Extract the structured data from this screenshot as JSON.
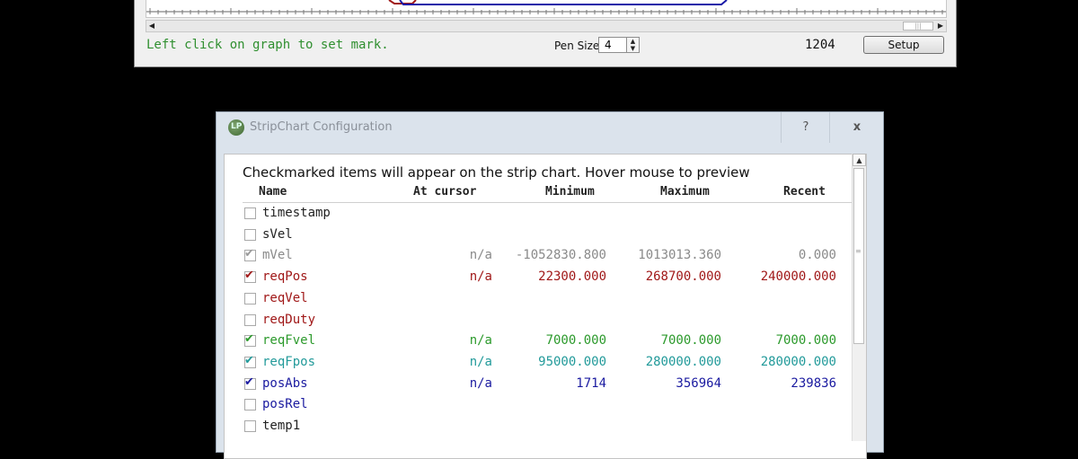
{
  "strip_window": {
    "status_hint": "Left click on graph to set mark.",
    "pen_size_label": "Pen Size:",
    "pen_size_value": "4",
    "count": "1204",
    "setup_label": "Setup",
    "colors": {
      "accent_red": "#a01818",
      "accent_blue": "#1a1aa8"
    }
  },
  "dialog": {
    "title": "StripChart Configuration",
    "help_label": "?",
    "close_label": "x",
    "instructions": "Checkmarked items will appear on the strip chart.   Hover mouse to preview",
    "columns": {
      "name": "Name",
      "at_cursor": "At cursor",
      "minimum": "Minimum",
      "maximum": "Maximum",
      "recent": "Recent"
    },
    "rows": [
      {
        "name": "timestamp",
        "checked": false,
        "color": "#222222",
        "at_cursor": "",
        "min": "",
        "max": "",
        "recent": ""
      },
      {
        "name": "sVel",
        "checked": false,
        "color": "#222222",
        "at_cursor": "",
        "min": "",
        "max": "",
        "recent": ""
      },
      {
        "name": "mVel",
        "checked": true,
        "disabled": true,
        "color": "#8a8a8a",
        "at_cursor": "n/a",
        "min": "-1052830.800",
        "max": "1013013.360",
        "recent": "0.000"
      },
      {
        "name": "reqPos",
        "checked": true,
        "color": "#a01818",
        "at_cursor": "n/a",
        "min": "22300.000",
        "max": "268700.000",
        "recent": "240000.000"
      },
      {
        "name": "reqVel",
        "checked": false,
        "color": "#a01818",
        "at_cursor": "",
        "min": "",
        "max": "",
        "recent": ""
      },
      {
        "name": "reqDuty",
        "checked": false,
        "color": "#a01818",
        "at_cursor": "",
        "min": "",
        "max": "",
        "recent": ""
      },
      {
        "name": "reqFvel",
        "checked": true,
        "color": "#2c9a2c",
        "at_cursor": "n/a",
        "min": "7000.000",
        "max": "7000.000",
        "recent": "7000.000"
      },
      {
        "name": "reqFpos",
        "checked": true,
        "color": "#229a9a",
        "at_cursor": "n/a",
        "min": "95000.000",
        "max": "280000.000",
        "recent": "280000.000"
      },
      {
        "name": "posAbs",
        "checked": true,
        "color": "#1a1aa0",
        "at_cursor": "n/a",
        "min": "1714",
        "max": "356964",
        "recent": "239836"
      },
      {
        "name": "posRel",
        "checked": false,
        "color": "#1a1aa0",
        "at_cursor": "",
        "min": "",
        "max": "",
        "recent": ""
      },
      {
        "name": "temp1",
        "checked": false,
        "color": "#222222",
        "at_cursor": "",
        "min": "",
        "max": "",
        "recent": ""
      }
    ]
  }
}
